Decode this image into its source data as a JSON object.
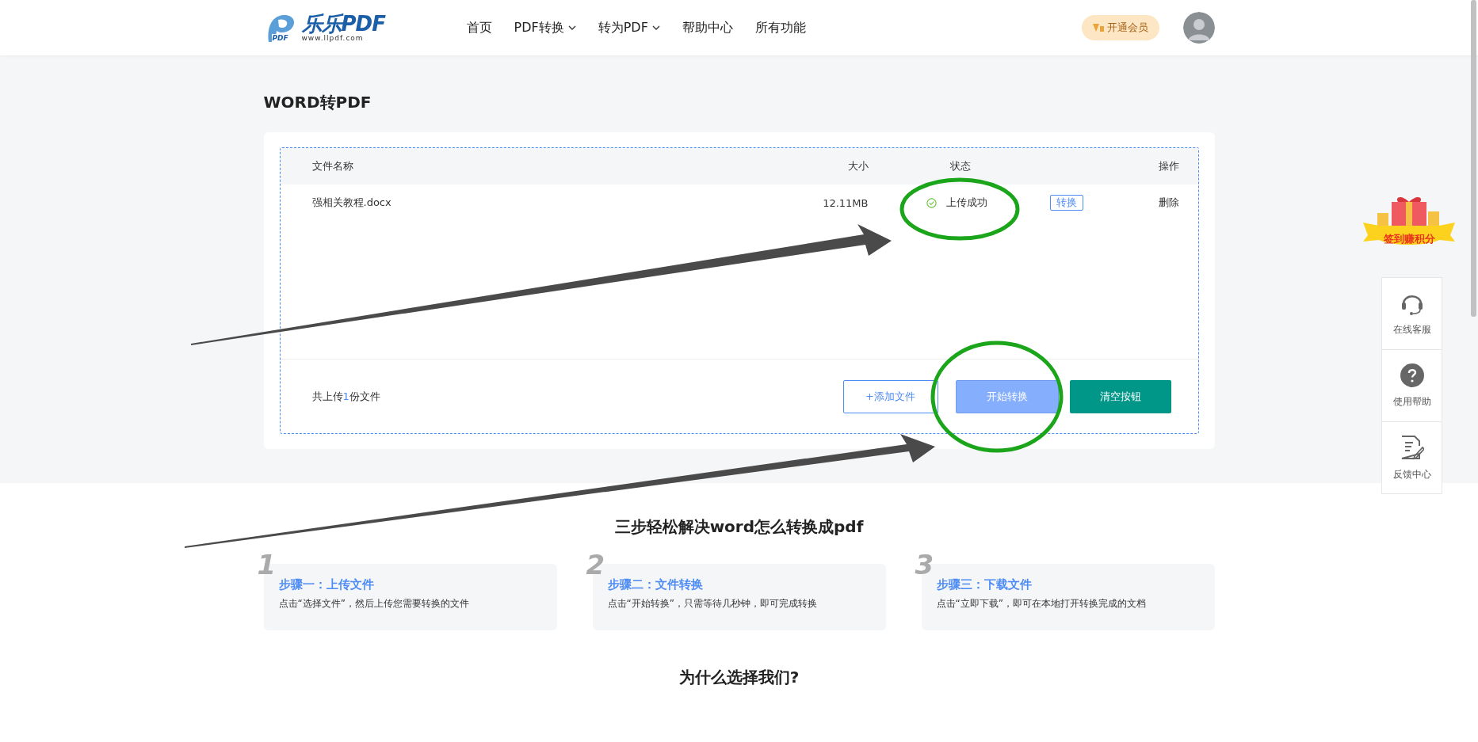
{
  "header": {
    "logo": {
      "name": "乐乐PDF",
      "url": "www.llpdf.com",
      "mark": "PDF"
    },
    "nav": [
      {
        "label": "首页",
        "dropdown": false
      },
      {
        "label": "PDF转换",
        "dropdown": true
      },
      {
        "label": "转为PDF",
        "dropdown": true
      },
      {
        "label": "帮助中心",
        "dropdown": false
      },
      {
        "label": "所有功能",
        "dropdown": false
      }
    ],
    "vip_button": "开通会员"
  },
  "page_title": "WORD转PDF",
  "file_table": {
    "columns": [
      "文件名称",
      "大小",
      "状态",
      "操作"
    ],
    "rows": [
      {
        "name": "强相关教程.docx",
        "size": "12.11MB",
        "status": {
          "kind": "success",
          "text": "上传成功"
        },
        "convert": "转换",
        "delete": "删除"
      }
    ],
    "summary": {
      "prefix": "共上传",
      "count": "1",
      "suffix": "份文件"
    },
    "buttons": [
      {
        "kind": "outline",
        "label": "+添加文件"
      },
      {
        "kind": "primary",
        "label": "开始转换"
      },
      {
        "kind": "danger",
        "label": "清空按钮"
      }
    ]
  },
  "steps_title": "三步轻松解决word怎么转换成pdf",
  "steps": [
    {
      "number": "1",
      "title": "步骤一：上传文件",
      "text": "点击“选择文件”，然后上传您需要转换的文件"
    },
    {
      "number": "2",
      "title": "步骤二：文件转换",
      "text": "点击“开始转换”，只需等待几秒钟，即可完成转换"
    },
    {
      "number": "3",
      "title": "步骤三：下载文件",
      "text": "点击“立即下载”，即可在本地打开转换完成的文档"
    }
  ],
  "why_title": "为什么选择我们?",
  "side": {
    "gift": "签到赚积分",
    "items": [
      {
        "kind": "service",
        "label": "在线客服"
      },
      {
        "kind": "help",
        "label": "使用帮助"
      },
      {
        "kind": "feedback",
        "label": "反馈中心"
      }
    ]
  }
}
